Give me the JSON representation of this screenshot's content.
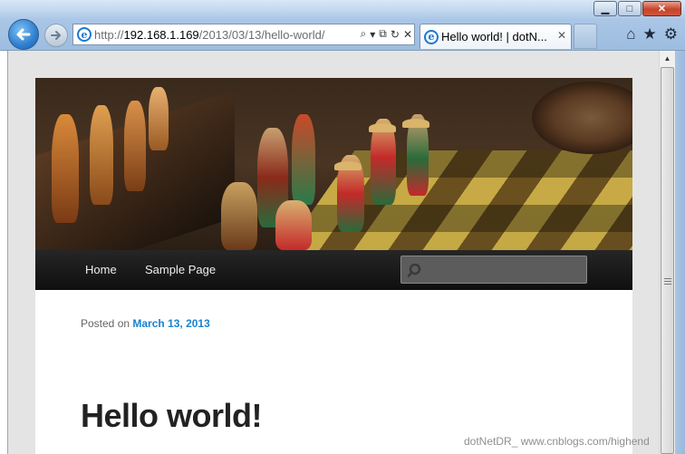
{
  "window": {
    "minimize_glyph": "▁",
    "maximize_glyph": "□",
    "close_glyph": "✕"
  },
  "toolbar": {
    "address_scheme": "http://",
    "address_host": "192.168.1.169",
    "address_path": "/2013/03/13/hello-world/",
    "search_glyph": "⌕",
    "dropdown_glyph": "▾",
    "compat_glyph": "⧉",
    "refresh_glyph": "↻",
    "stop_glyph": "✕"
  },
  "tab": {
    "title": "Hello world! | dotN...",
    "close_glyph": "✕"
  },
  "tools": {
    "home_glyph": "⌂",
    "favorites_glyph": "★",
    "settings_glyph": "⚙"
  },
  "site": {
    "nav": [
      {
        "label": "Home"
      },
      {
        "label": "Sample Page"
      }
    ],
    "search_placeholder": ""
  },
  "post": {
    "posted_prefix": "Posted on",
    "date": "March 13, 2013",
    "title": "Hello world!"
  },
  "watermark": "dotNetDR_  www.cnblogs.com/highend",
  "colors": {
    "link": "#1982d1",
    "nav_bg": "#1a1a1a",
    "title": "#222222"
  }
}
